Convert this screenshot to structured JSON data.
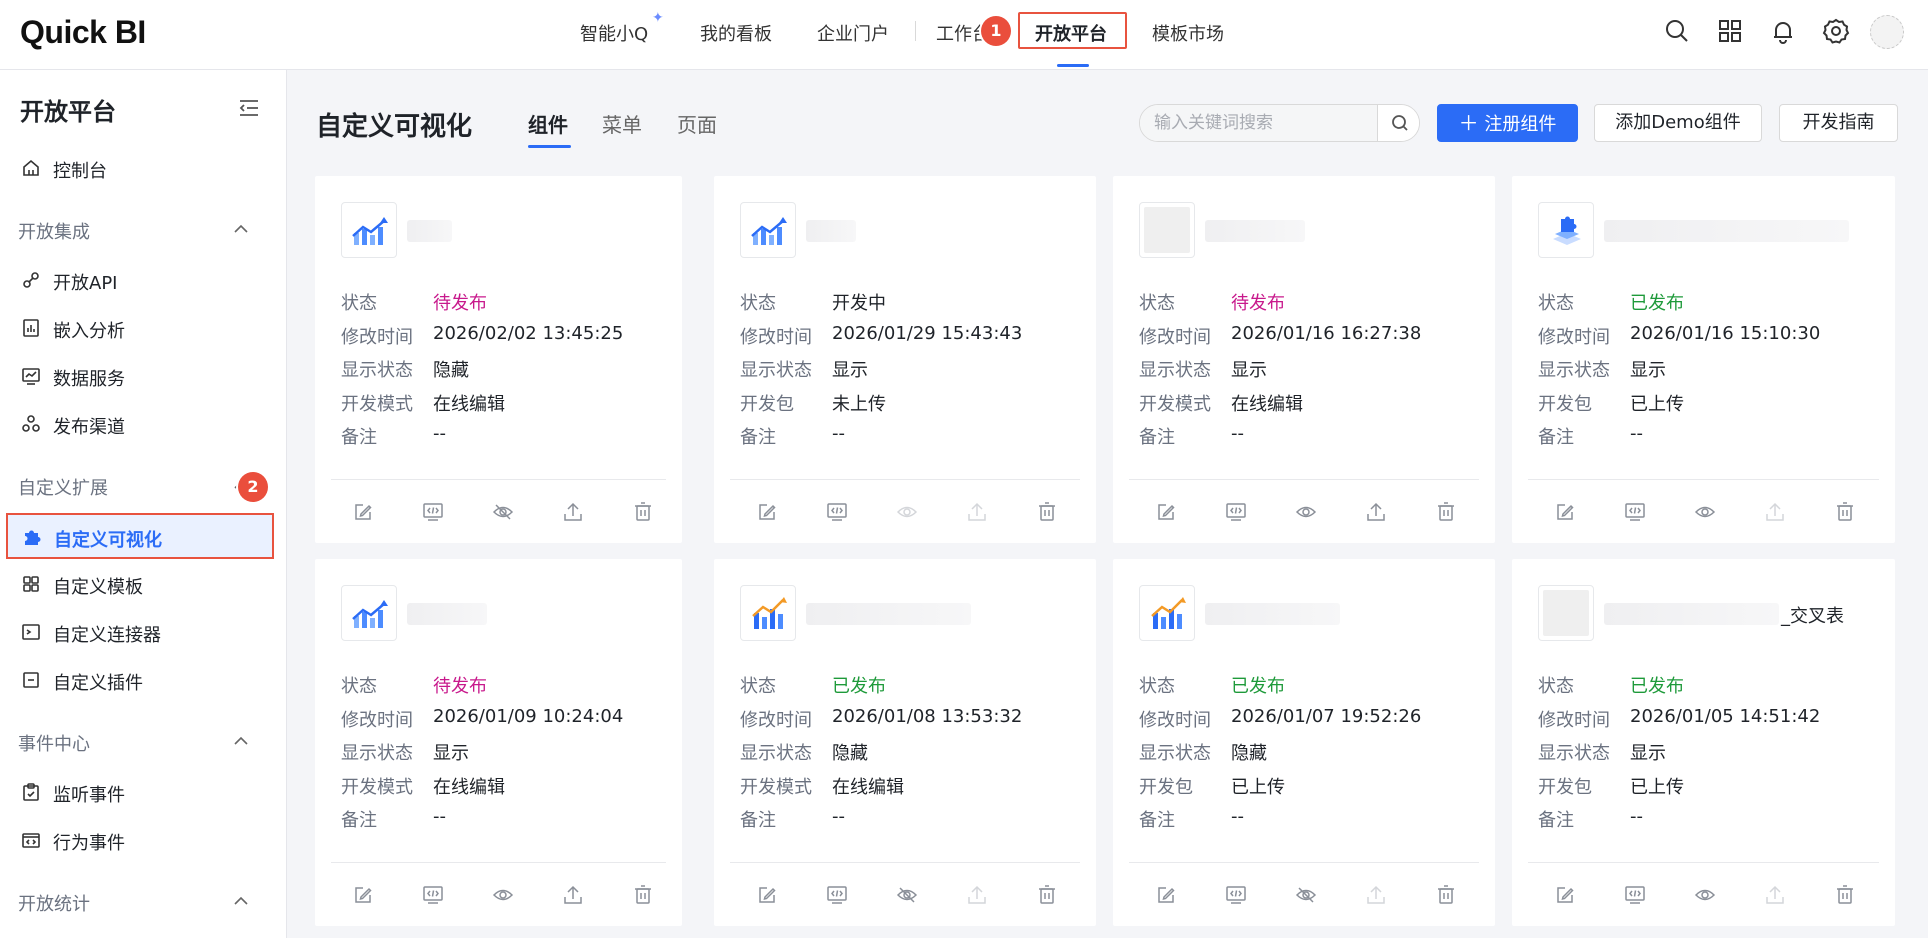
{
  "app": {
    "logo_text": "Quick BI"
  },
  "topnav": {
    "items": [
      "智能小Q",
      "我的看板",
      "企业门户",
      "工作台",
      "开放平台",
      "模板市场"
    ],
    "active": "开放平台",
    "step_badge_1": "1"
  },
  "sidebar": {
    "title": "开放平台",
    "dashboard": "控制台",
    "groups": [
      {
        "label": "开放集成",
        "items": [
          "开放API",
          "嵌入分析",
          "数据服务",
          "发布渠道"
        ]
      },
      {
        "label": "自定义扩展",
        "items": [
          "自定义可视化",
          "自定义模板",
          "自定义连接器",
          "自定义插件"
        ]
      },
      {
        "label": "事件中心",
        "items": [
          "监听事件",
          "行为事件"
        ]
      },
      {
        "label": "开放统计",
        "items": []
      }
    ],
    "active_item": "自定义可视化",
    "step_badge_2": "2"
  },
  "main": {
    "title": "自定义可视化",
    "tabs": [
      "组件",
      "菜单",
      "页面"
    ],
    "active_tab": "组件",
    "search": {
      "placeholder": "输入关键词搜索",
      "value": ""
    },
    "buttons": {
      "register": "注册组件",
      "add_demo": "添加Demo组件",
      "dev_guide": "开发指南"
    }
  },
  "cards": [
    {
      "name_suffix": "",
      "icon": "line-chart-icon",
      "rows": [
        [
          "状态",
          "待发布",
          "pending"
        ],
        [
          "修改时间",
          "2026/02/02 13:45:25",
          ""
        ],
        [
          "显示状态",
          "隐藏",
          ""
        ],
        [
          "开发模式",
          "在线编辑",
          ""
        ],
        [
          "备注",
          "--",
          ""
        ]
      ],
      "hidden": true,
      "eye_disabled": false,
      "upload_disabled": false
    },
    {
      "name_suffix": "",
      "icon": "line-chart-icon",
      "rows": [
        [
          "状态",
          "开发中",
          ""
        ],
        [
          "修改时间",
          "2026/01/29 15:43:43",
          ""
        ],
        [
          "显示状态",
          "显示",
          ""
        ],
        [
          "开发包",
          "未上传",
          ""
        ],
        [
          "备注",
          "--",
          ""
        ]
      ],
      "hidden": false,
      "eye_disabled": true,
      "upload_disabled": true
    },
    {
      "name_suffix": "",
      "icon": "blank-icon",
      "rows": [
        [
          "状态",
          "待发布",
          "pending"
        ],
        [
          "修改时间",
          "2026/01/16 16:27:38",
          ""
        ],
        [
          "显示状态",
          "显示",
          ""
        ],
        [
          "开发模式",
          "在线编辑",
          ""
        ],
        [
          "备注",
          "--",
          ""
        ]
      ],
      "hidden": false,
      "eye_disabled": false,
      "upload_disabled": false
    },
    {
      "name_suffix": "",
      "icon": "plugin-icon",
      "rows": [
        [
          "状态",
          "已发布",
          "published"
        ],
        [
          "修改时间",
          "2026/01/16 15:10:30",
          ""
        ],
        [
          "显示状态",
          "显示",
          ""
        ],
        [
          "开发包",
          "已上传",
          ""
        ],
        [
          "备注",
          "--",
          ""
        ]
      ],
      "hidden": false,
      "eye_disabled": false,
      "upload_disabled": true
    },
    {
      "name_suffix": "",
      "icon": "line-chart-icon",
      "rows": [
        [
          "状态",
          "待发布",
          "pending"
        ],
        [
          "修改时间",
          "2026/01/09 10:24:04",
          ""
        ],
        [
          "显示状态",
          "显示",
          ""
        ],
        [
          "开发模式",
          "在线编辑",
          ""
        ],
        [
          "备注",
          "--",
          ""
        ]
      ],
      "hidden": false,
      "eye_disabled": false,
      "upload_disabled": false
    },
    {
      "name_suffix": "",
      "icon": "bar-chart-icon",
      "rows": [
        [
          "状态",
          "已发布",
          "published"
        ],
        [
          "修改时间",
          "2026/01/08 13:53:32",
          ""
        ],
        [
          "显示状态",
          "隐藏",
          ""
        ],
        [
          "开发模式",
          "在线编辑",
          ""
        ],
        [
          "备注",
          "--",
          ""
        ]
      ],
      "hidden": true,
      "eye_disabled": false,
      "upload_disabled": true
    },
    {
      "name_suffix": "",
      "icon": "bar-chart-icon",
      "rows": [
        [
          "状态",
          "已发布",
          "published"
        ],
        [
          "修改时间",
          "2026/01/07 19:52:26",
          ""
        ],
        [
          "显示状态",
          "隐藏",
          ""
        ],
        [
          "开发包",
          "已上传",
          ""
        ],
        [
          "备注",
          "--",
          ""
        ]
      ],
      "hidden": true,
      "eye_disabled": false,
      "upload_disabled": true
    },
    {
      "name_suffix": "_交叉表",
      "icon": "blank-icon",
      "rows": [
        [
          "状态",
          "已发布",
          "published"
        ],
        [
          "修改时间",
          "2026/01/05 14:51:42",
          ""
        ],
        [
          "显示状态",
          "显示",
          ""
        ],
        [
          "开发包",
          "已上传",
          ""
        ],
        [
          "备注",
          "--",
          ""
        ]
      ],
      "hidden": false,
      "eye_disabled": false,
      "upload_disabled": true
    }
  ],
  "colors": {
    "accent": "#2b6cf6",
    "highlight_box": "#e8533f",
    "pending": "#c8198c",
    "published": "#1e9a3a"
  }
}
